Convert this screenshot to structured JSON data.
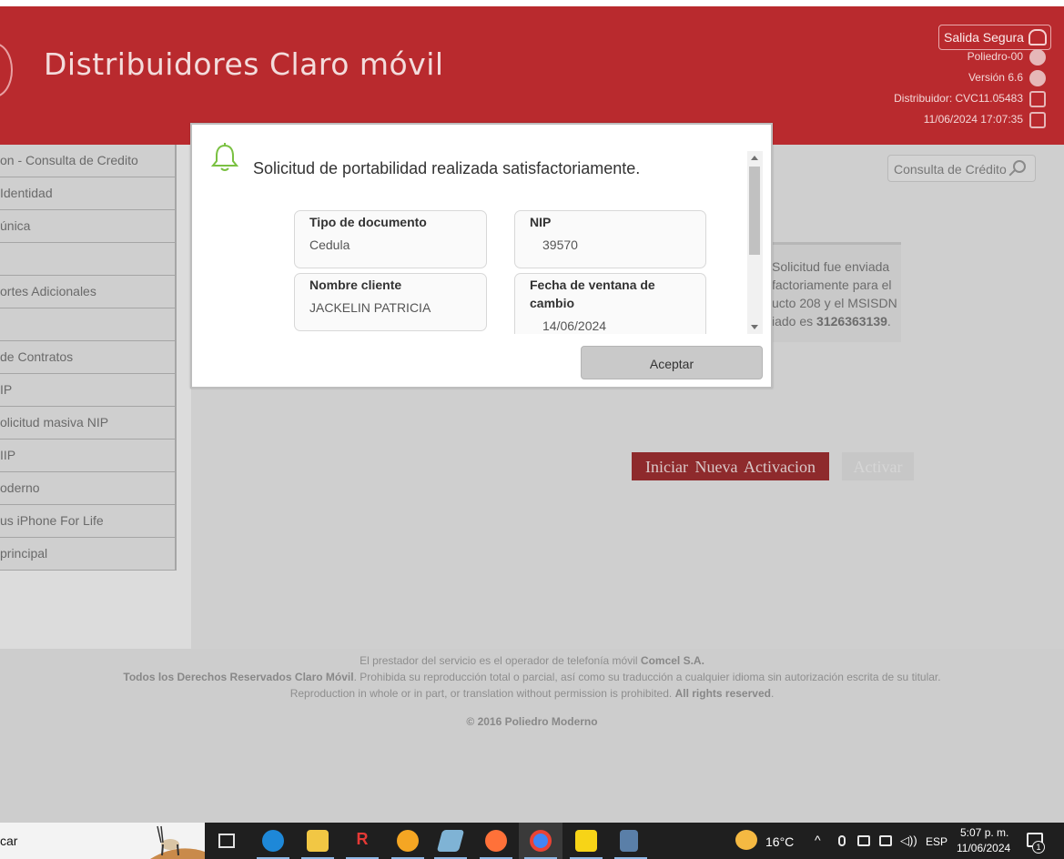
{
  "header": {
    "title": "Distribuidores Claro móvil",
    "logout_label": "Salida Segura",
    "info": [
      "Poliedro-00",
      "Versión 6.6",
      "Distribuidor: CVC11.05483",
      "11/06/2024 17:07:35"
    ]
  },
  "sidebar": {
    "items": [
      {
        "label": "on - Consulta de Credito"
      },
      {
        "label": "Identidad"
      },
      {
        "label": "única"
      },
      {
        "label": ""
      },
      {
        "label": "ortes Adicionales"
      },
      {
        "label": ""
      },
      {
        "label": "de Contratos"
      },
      {
        "label": "IP"
      },
      {
        "label": "olicitud masiva NIP"
      },
      {
        "label": "IIP"
      },
      {
        "label": "oderno"
      },
      {
        "label": "us iPhone For Life"
      },
      {
        "label": "principal"
      }
    ]
  },
  "main": {
    "search_label": "Consulta de Crédito",
    "info_lines": [
      "Solicitud fue enviada",
      "factoriamente para el",
      "ucto 208 y el MSISDN",
      "iado es "
    ],
    "info_msisdn": "3126363139",
    "btn_new": "Iniciar Nueva Activacion",
    "btn_activate": "Activar"
  },
  "modal": {
    "message": "Solicitud de portabilidad realizada satisfactoriamente.",
    "fields": {
      "tipo_documento": {
        "label": "Tipo de documento",
        "value": "Cedula"
      },
      "nip": {
        "label": "NIP",
        "value": "39570"
      },
      "nombre_cliente": {
        "label": "Nombre cliente",
        "value": "JACKELIN PATRICIA"
      },
      "fecha_ventana": {
        "label": "Fecha de ventana de cambio",
        "value": "14/06/2024"
      }
    },
    "accept_label": "Aceptar"
  },
  "footer": {
    "line1_prefix": "El prestador del servicio es el operador de telefonía móvil ",
    "line1_bold": "Comcel S.A.",
    "line2_bold": "Todos los Derechos Reservados Claro Móvil",
    "line2_rest": ". Prohibida su reproducción total o parcial, así como su traducción a cualquier idioma sin autorización escrita de su titular.",
    "line3_prefix": "Reproduction in whole or in part, or translation without permission is prohibited. ",
    "line3_bold": "All rights reserved",
    "copyright": "© 2016 Poliedro Moderno"
  },
  "taskbar": {
    "search_text": "car",
    "weather": "16°C",
    "lang": "ESP",
    "time": "5:07 p. m.",
    "date": "11/06/2024",
    "notif_count": "1"
  },
  "colors": {
    "brand_red": "#b92a2e",
    "overlay_gray": "#cfcfcf",
    "bell_green": "#7ac142"
  }
}
